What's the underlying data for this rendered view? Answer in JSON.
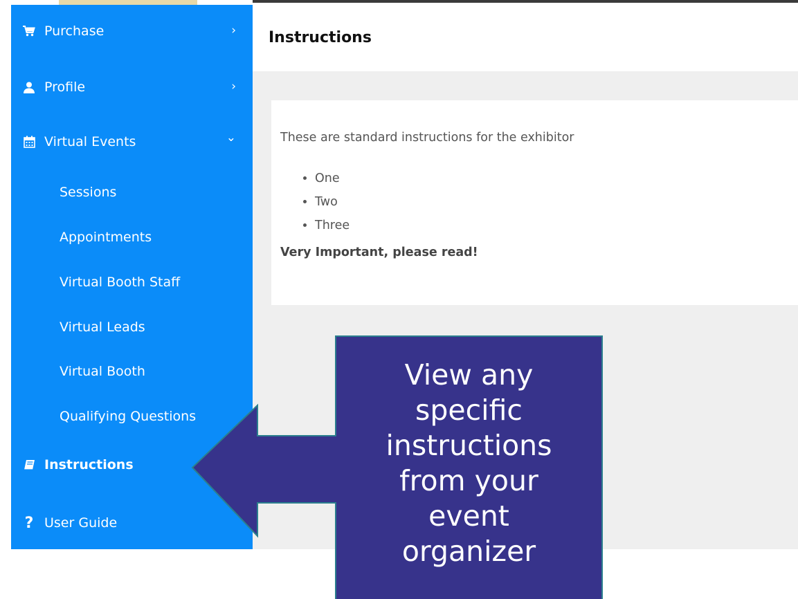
{
  "sidebar": {
    "items": [
      {
        "label": "Purchase",
        "icon": "cart-icon",
        "chevron": "›"
      },
      {
        "label": "Profile",
        "icon": "user-icon",
        "chevron": "›"
      },
      {
        "label": "Virtual Events",
        "icon": "calendar-icon",
        "chevron": "⌄"
      }
    ],
    "subitems": [
      {
        "label": "Sessions"
      },
      {
        "label": "Appointments"
      },
      {
        "label": "Virtual Booth Staff"
      },
      {
        "label": "Virtual Leads"
      },
      {
        "label": "Virtual Booth"
      },
      {
        "label": "Qualifying Questions"
      }
    ],
    "instructions": {
      "label": "Instructions",
      "icon": "book-icon"
    },
    "user_guide": {
      "label": "User Guide",
      "icon": "question-icon"
    }
  },
  "main": {
    "title": "Instructions",
    "card": {
      "intro": "These are standard instructions for the exhibitor",
      "list": [
        "One",
        "Two",
        "Three"
      ],
      "important": "Very Important, please read!"
    }
  },
  "callout": {
    "lines": [
      "View any",
      "specific",
      "instructions",
      "from your",
      "event",
      "organizer"
    ]
  },
  "colors": {
    "sidebar": "#0b8cf9",
    "callout": "#37338b",
    "callout_border": "#2b7f8e",
    "content_bg": "#efefef"
  }
}
